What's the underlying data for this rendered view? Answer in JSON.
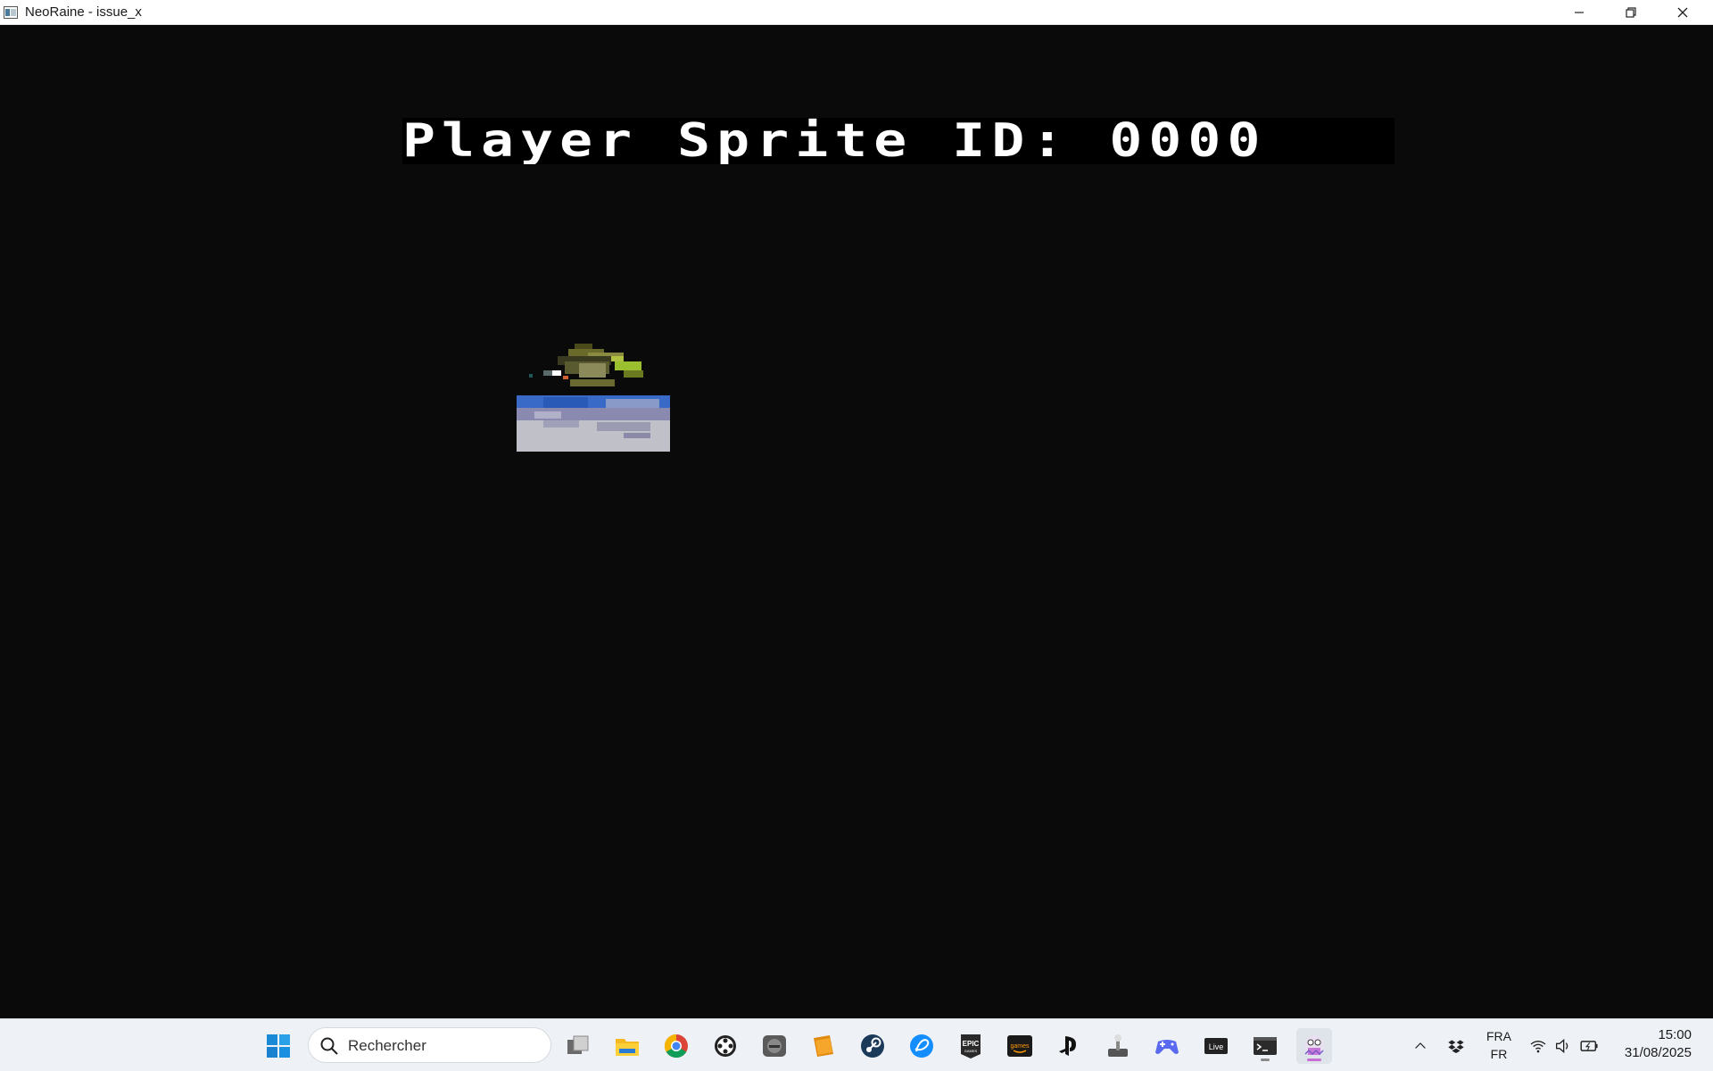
{
  "window": {
    "title": "NeoRaine - issue_x"
  },
  "game": {
    "title_text": "Player Sprite ID: 0000",
    "sprite_icon": "spaceship-over-water-sprite"
  },
  "taskbar": {
    "search_placeholder": "Rechercher",
    "apps": [
      "windows-start-icon",
      "task-view-icon",
      "file-explorer-icon",
      "chrome-icon",
      "gamepad-launcher-icon",
      "retro-console-icon",
      "folder-app-icon",
      "steam-icon",
      "battlenet-icon",
      "epic-games-icon",
      "amazon-games-icon",
      "playstation-icon",
      "joystick-icon",
      "controller-icon",
      "live-icon",
      "terminal-icon",
      "neoraine-icon"
    ],
    "language_top": "FRA",
    "language_bottom": "FR",
    "time": "15:00",
    "date": "31/08/2025"
  }
}
